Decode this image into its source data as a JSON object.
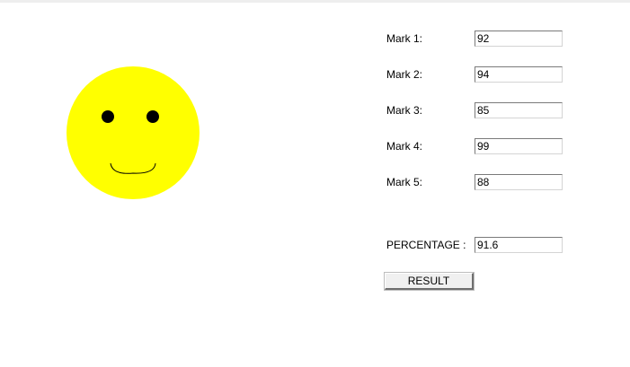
{
  "smiley": {
    "face_color": "#ffff00",
    "feature_color": "#000000",
    "icon": "smiley-face-icon"
  },
  "marks": [
    {
      "label": "Mark 1:",
      "value": "92"
    },
    {
      "label": "Mark 2:",
      "value": "94"
    },
    {
      "label": "Mark 3:",
      "value": "85"
    },
    {
      "label": "Mark 4:",
      "value": "99"
    },
    {
      "label": "Mark 5:",
      "value": "88"
    }
  ],
  "percentage": {
    "label": "PERCENTAGE :",
    "value": "91.6"
  },
  "result_button": {
    "label": "RESULT"
  }
}
